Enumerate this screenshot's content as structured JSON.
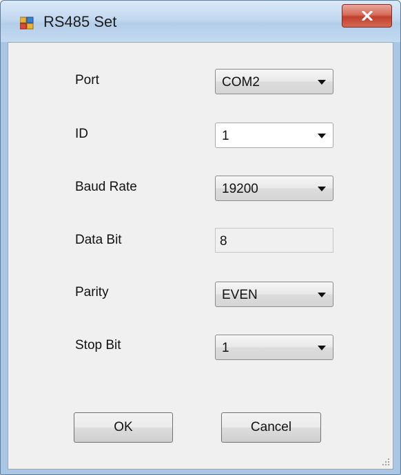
{
  "window": {
    "title": "RS485 Set",
    "close_glyph": "X"
  },
  "form": {
    "port": {
      "label": "Port",
      "value": "COM2"
    },
    "id": {
      "label": "ID",
      "value": "1"
    },
    "baud_rate": {
      "label": "Baud Rate",
      "value": "19200"
    },
    "data_bit": {
      "label": "Data Bit",
      "value": "8"
    },
    "parity": {
      "label": "Parity",
      "value": "EVEN"
    },
    "stop_bit": {
      "label": "Stop Bit",
      "value": "1"
    }
  },
  "buttons": {
    "ok": "OK",
    "cancel": "Cancel"
  },
  "icons": {
    "app": "app-window-icon",
    "close": "close-icon",
    "dropdown": "chevron-down-icon",
    "resize": "resize-grip-icon"
  },
  "colors": {
    "close_button": "#c9503b",
    "client_background": "#f0f0f0",
    "title_bar": "#c2d8f0"
  }
}
